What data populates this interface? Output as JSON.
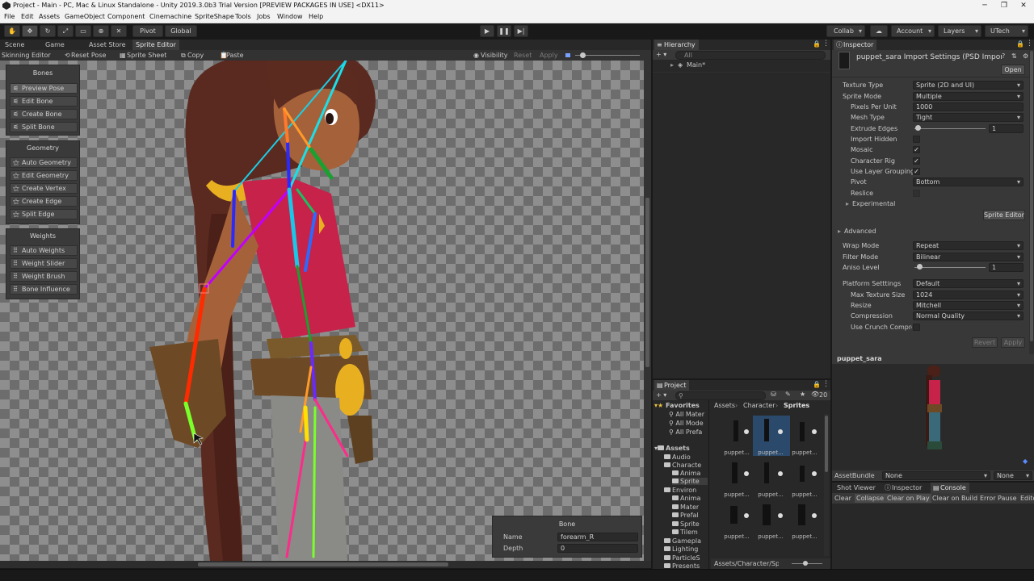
{
  "window": {
    "title": "Project - Main - PC, Mac & Linux Standalone - Unity 2019.3.0b3 Trial Version [PREVIEW PACKAGES IN USE] <DX11>",
    "minimize": "─",
    "maximize": "❐",
    "close": "✕"
  },
  "menu": [
    "File",
    "Edit",
    "Assets",
    "GameObject",
    "Component",
    "Cinemachine",
    "SpriteShape",
    "Tools",
    "Jobs",
    "Window",
    "Help"
  ],
  "toolbar": {
    "pivot": "Pivot",
    "global": "Global",
    "collab": "Collab",
    "account": "Account",
    "layers": "Layers",
    "layout": "UTech"
  },
  "scene_tabs": [
    "Scene",
    "Game",
    "Asset Store",
    "Sprite Editor"
  ],
  "sprite_toolbar": {
    "skinning_editor": "Skinning Editor",
    "reset_pose": "Reset Pose",
    "sprite_sheet": "Sprite Sheet",
    "copy": "Copy",
    "paste": "Paste",
    "visibility": "Visibility",
    "reset": "Reset",
    "apply": "Apply"
  },
  "bones_panel": {
    "title": "Bones",
    "buttons": [
      "Preview Pose",
      "Edit Bone",
      "Create Bone",
      "Split Bone"
    ]
  },
  "geometry_panel": {
    "title": "Geometry",
    "buttons": [
      "Auto Geometry",
      "Edit Geometry",
      "Create Vertex",
      "Create Edge",
      "Split Edge"
    ]
  },
  "weights_panel": {
    "title": "Weights",
    "buttons": [
      "Auto Weights",
      "Weight Slider",
      "Weight Brush",
      "Bone Influence"
    ]
  },
  "bone_info": {
    "title": "Bone",
    "name_label": "Name",
    "name_value": "forearm_R",
    "depth_label": "Depth",
    "depth_value": "0"
  },
  "hierarchy": {
    "tab": "Hierarchy",
    "add": "+ ▾",
    "search_placeholder": "All",
    "scene_item": "Main*"
  },
  "project": {
    "tab": "Project",
    "count": "20",
    "favorites_label": "Favorites",
    "favorites": [
      "All Mater",
      "All Mode",
      "All Prefa"
    ],
    "assets_label": "Assets",
    "tree": [
      "Audio",
      "Characte",
      "Anima",
      "Sprite",
      "Environ",
      "Anima",
      "Mater",
      "Prefal",
      "Sprite",
      "Tilem",
      "Gamepla",
      "Lighting",
      "ParticleS",
      "Presents"
    ],
    "breadcrumb": [
      "Assets",
      "Character",
      "Sprites"
    ],
    "thumb_label": "puppet...",
    "footer_path": "Assets/Character/Sprit"
  },
  "inspector": {
    "tab": "Inspector",
    "header": "puppet_sara Import Settings (PSD Importe",
    "open": "Open",
    "rows": [
      {
        "label": "Texture Type",
        "value": "Sprite (2D and UI)",
        "kind": "dropdown"
      },
      {
        "label": "Sprite Mode",
        "value": "Multiple",
        "kind": "dropdown"
      },
      {
        "label": "Pixels Per Unit",
        "value": "1000",
        "kind": "field"
      },
      {
        "label": "Mesh Type",
        "value": "Tight",
        "kind": "dropdown"
      },
      {
        "label": "Extrude Edges",
        "value": "1",
        "kind": "slider"
      },
      {
        "label": "Import Hidden",
        "value": "",
        "kind": "check"
      },
      {
        "label": "Mosaic",
        "value": "✓",
        "kind": "check"
      },
      {
        "label": "Character Rig",
        "value": "✓",
        "kind": "check"
      },
      {
        "label": "Use Layer Grouping",
        "value": "✓",
        "kind": "check"
      },
      {
        "label": "Pivot",
        "value": "Bottom",
        "kind": "dropdown"
      },
      {
        "label": "Reslice",
        "value": "",
        "kind": "check"
      }
    ],
    "experimental": "Experimental",
    "sprite_editor": "Sprite Editor",
    "advanced": "Advanced",
    "rows2": [
      {
        "label": "Wrap Mode",
        "value": "Repeat"
      },
      {
        "label": "Filter Mode",
        "value": "Bilinear"
      },
      {
        "label": "Aniso Level",
        "value": "1"
      }
    ],
    "platform_label": "Platform Setttings",
    "platform_value": "Default",
    "rows3": [
      {
        "label": "Max Texture Size",
        "value": "1024"
      },
      {
        "label": "Resize",
        "value": "Mitchell"
      },
      {
        "label": "Compression",
        "value": "Normal Quality"
      },
      {
        "label": "Use Crunch Compre",
        "value": ""
      }
    ],
    "revert": "Revert",
    "apply": "Apply",
    "preview_title": "puppet_sara",
    "assetbundle_label": "AssetBundle",
    "assetbundle_value": "None",
    "assetbundle_variant": "None"
  },
  "bottom_tabs": [
    "Shot Viewer",
    "Inspector",
    "Console"
  ],
  "console_buttons": [
    "Clear",
    "Collapse",
    "Clear on Play",
    "Clear on Build",
    "Error Pause",
    "Edito"
  ]
}
